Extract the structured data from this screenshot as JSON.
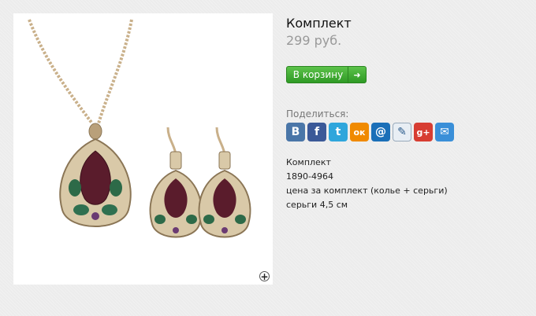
{
  "product": {
    "title": "Комплект",
    "price": "299 руб."
  },
  "actions": {
    "cart_label": "В корзину",
    "cart_arrow": "➜"
  },
  "image": {
    "zoom_glyph": "+",
    "subject": "Necklace and earrings set with teardrop pendant"
  },
  "share": {
    "label": "Поделиться:",
    "icons": [
      {
        "name": "vk-icon",
        "glyph": "B",
        "bg": "#4a76a8"
      },
      {
        "name": "facebook-icon",
        "glyph": "f",
        "bg": "#3b5998"
      },
      {
        "name": "twitter-icon",
        "glyph": "t",
        "bg": "#2fa6dc"
      },
      {
        "name": "odnoklassniki-icon",
        "glyph": "ок",
        "bg": "#f08a00"
      },
      {
        "name": "mail-icon",
        "glyph": "@",
        "bg": "#1a6fb8"
      },
      {
        "name": "livejournal-icon",
        "glyph": "✎",
        "bg": "#e8eef4"
      },
      {
        "name": "googleplus-icon",
        "glyph": "g+",
        "bg": "#d73d32"
      },
      {
        "name": "email-icon",
        "glyph": "✉",
        "bg": "#3a8fd8"
      }
    ]
  },
  "description": {
    "line1": "Комплект",
    "line2": "1890-4964",
    "line3": "цена за комплект (колье + серьги)",
    "line4": "серьги 4,5 см"
  }
}
